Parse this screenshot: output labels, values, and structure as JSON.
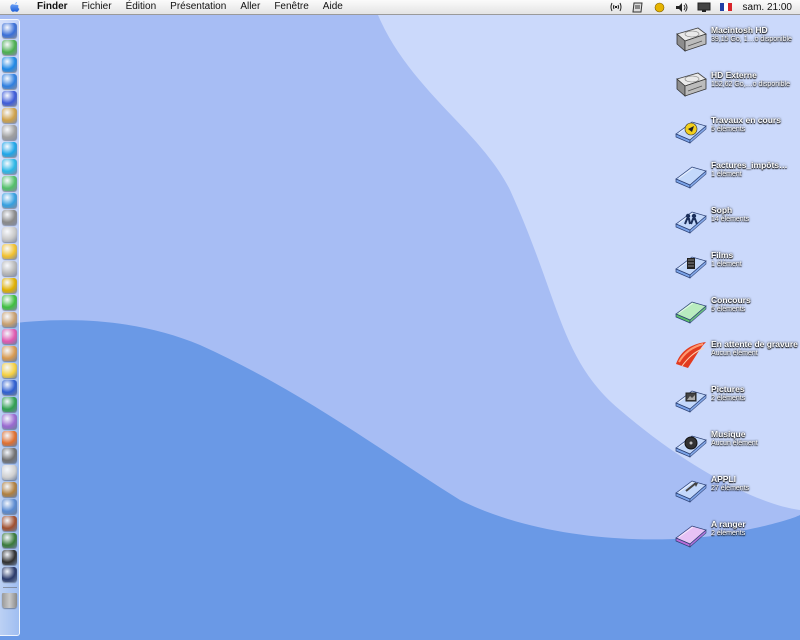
{
  "menubar": {
    "app": "Finder",
    "items": [
      "Fichier",
      "Édition",
      "Présentation",
      "Aller",
      "Fenêtre",
      "Aide"
    ],
    "clock": "sam. 21:00",
    "status_icons": [
      "airport-icon",
      "script-icon",
      "sun-icon",
      "volume-icon",
      "display-icon",
      "french-flag-icon"
    ]
  },
  "dock": {
    "colors": [
      "#3a6fd8",
      "#4caf50",
      "#1e88e5",
      "#2f7fe0",
      "#3d5bd8",
      "#cfa24a",
      "#a0a0a0",
      "#1ea6e8",
      "#2bb7e6",
      "#53c06a",
      "#36a0e0",
      "#8a8a8a",
      "#c9c9c9",
      "#f2c12e",
      "#b9b9b9",
      "#e0b000",
      "#3fbf3f",
      "#c8a070",
      "#e05ab0",
      "#d89a50",
      "#f5d040",
      "#2f5fd0",
      "#30a050",
      "#9a6ad0",
      "#e07030",
      "#707070",
      "#d0d0d0",
      "#b08040",
      "#5a8ad0",
      "#a05030",
      "#3a7a3a",
      "#303030",
      "#2a3a6a"
    ],
    "trash_color": "#c8c8c8"
  },
  "desktop": [
    {
      "name": "Macintosh HD",
      "info": "39,15 Go, 1…o disponible",
      "icon": "hard-drive-icon"
    },
    {
      "name": "HD Externe",
      "info": "152,62 Go,…o disponible",
      "icon": "hard-drive-icon"
    },
    {
      "name": "Travaux en cours",
      "info": "5 éléments",
      "icon": "folder-yellow-arrow-icon"
    },
    {
      "name": "Factures_impôts…",
      "info": "1 élément",
      "icon": "folder-icon"
    },
    {
      "name": "Soph",
      "info": "14 éléments",
      "icon": "folder-people-icon"
    },
    {
      "name": "Films",
      "info": "1 élément",
      "icon": "folder-film-icon"
    },
    {
      "name": "Concours",
      "info": "5 éléments",
      "icon": "folder-green-icon"
    },
    {
      "name": "En attente de gravure",
      "info": "Aucun élément",
      "icon": "burn-folder-icon"
    },
    {
      "name": "Pictures",
      "info": "2 éléments",
      "icon": "folder-pictures-icon"
    },
    {
      "name": "Musique",
      "info": "Aucun élément",
      "icon": "folder-music-icon"
    },
    {
      "name": "APPLI",
      "info": "27 éléments",
      "icon": "folder-apps-icon"
    },
    {
      "name": "A ranger",
      "info": "2 éléments",
      "icon": "folder-purple-icon"
    }
  ]
}
